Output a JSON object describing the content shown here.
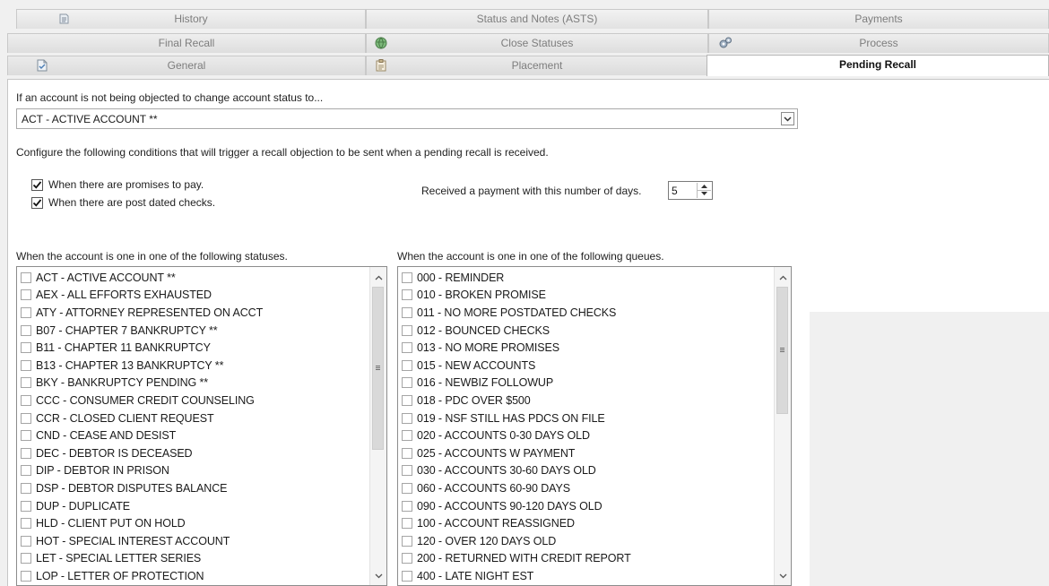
{
  "tabs": {
    "row1": [
      {
        "label": "History",
        "icon": "history-icon"
      },
      {
        "label": "Status and Notes (ASTS)",
        "icon": ""
      },
      {
        "label": "Payments",
        "icon": ""
      }
    ],
    "row2": [
      {
        "label": "Final Recall",
        "icon": ""
      },
      {
        "label": "Close Statuses",
        "icon": "globe-icon"
      },
      {
        "label": "Process",
        "icon": "gears-icon"
      }
    ],
    "row3": [
      {
        "label": "General",
        "icon": "document-icon"
      },
      {
        "label": "Placement",
        "icon": "clipboard-icon"
      },
      {
        "label": "Pending Recall",
        "icon": "",
        "active": true
      }
    ]
  },
  "main": {
    "status_prompt": "If an account is not being objected to change account status to...",
    "status_combo": {
      "value": "ACT - ACTIVE ACCOUNT **"
    },
    "conditions_intro": "Configure the following conditions that will trigger a recall objection to be sent when a pending recall is received.",
    "promises_checkbox": {
      "label": "When there are promises to pay.",
      "checked": true
    },
    "postdated_checkbox": {
      "label": "When there are post dated checks.",
      "checked": true
    },
    "payment_days": {
      "label": "Received a payment with this number of days.",
      "value": "5"
    },
    "statuses_label": "When the account is one in one of the following statuses.",
    "queues_label": "When the account is one in one of the following queues.",
    "statuses": [
      "ACT - ACTIVE ACCOUNT **",
      "AEX - ALL EFFORTS EXHAUSTED",
      "ATY - ATTORNEY REPRESENTED ON ACCT",
      "B07 - CHAPTER 7 BANKRUPTCY **",
      "B11 - CHAPTER 11 BANKRUPTCY",
      "B13 - CHAPTER 13 BANKRUPTCY **",
      "BKY - BANKRUPTCY PENDING **",
      "CCC - CONSUMER CREDIT COUNSELING",
      "CCR - CLOSED CLIENT REQUEST",
      "CND - CEASE AND DESIST",
      "DEC - DEBTOR IS DECEASED",
      "DIP - DEBTOR IN PRISON",
      "DSP - DEBTOR DISPUTES BALANCE",
      "DUP - DUPLICATE",
      "HLD - CLIENT PUT ON HOLD",
      "HOT - SPECIAL INTEREST ACCOUNT",
      "LET - SPECIAL LETTER SERIES",
      "LOP - LETTER OF PROTECTION"
    ],
    "queues": [
      "000 - REMINDER",
      "010 - BROKEN PROMISE",
      "011 - NO MORE POSTDATED CHECKS",
      "012 - BOUNCED CHECKS",
      "013 - NO MORE PROMISES",
      "015 - NEW ACCOUNTS",
      "016 - NEWBIZ FOLLOWUP",
      "018 - PDC OVER $500",
      "019 - NSF STILL HAS PDCS ON FILE",
      "020 - ACCOUNTS 0-30 DAYS OLD",
      "025 - ACCOUNTS  W PAYMENT",
      "030 - ACCOUNTS 30-60 DAYS OLD",
      "060 - ACCOUNTS 60-90 DAYS",
      "090 - ACCOUNTS  90-120 DAYS OLD",
      "100 - ACCOUNT REASSIGNED",
      "120 - OVER 120 DAYS OLD",
      "200 - RETURNED WITH CREDIT REPORT",
      "400 - LATE NIGHT EST"
    ]
  },
  "colors": {
    "active_tab": "#ffffff",
    "panel": "#f0f0f0",
    "text": "#1a1a1a"
  }
}
